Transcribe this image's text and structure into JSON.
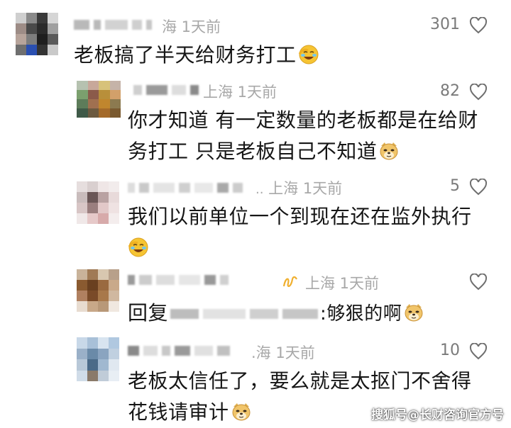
{
  "comments": [
    {
      "meta": "海 1天前",
      "likes": "301",
      "text": "老板搞了半天给财务打工",
      "emoji": "facepalm-laugh-emoji"
    },
    {
      "meta": "上海 1天前",
      "likes": "82",
      "text_line1": "你才知道 有一定数量的老板都是在给财",
      "text_line2": "务打工 只是老板自己不知道",
      "emoji": "doge-emoji"
    },
    {
      "meta": "上海 1天前",
      "likes": "5",
      "text_line1": "我们以前单位一个到现在还在监外执行",
      "emoji": "facepalm-laugh-emoji"
    },
    {
      "meta": "上海 1天前",
      "likes": "",
      "reply_prefix": "回复",
      "text": ":够狠的啊",
      "emoji": "doge-emoji"
    },
    {
      "meta": ".海 1天前",
      "likes": "10",
      "text_line1": "老板太信任了，要么就是太抠门不舍得",
      "text_line2": "花钱请审计",
      "emoji": "doge-emoji"
    }
  ],
  "watermark": "搜狐号@长财咨询官方号",
  "colors": {
    "meta_gray": "#a8a8a8",
    "text": "#161616",
    "heart_stroke": "#6f6f6f"
  }
}
